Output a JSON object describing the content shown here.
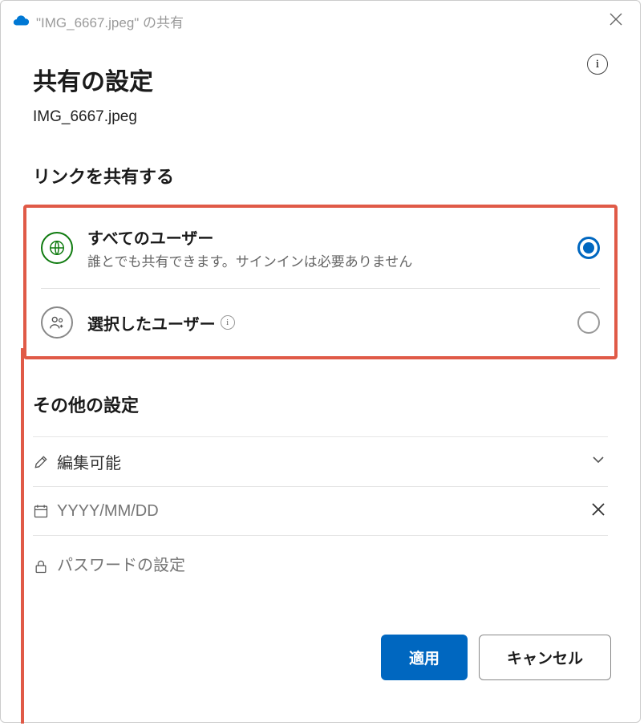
{
  "titlebar": {
    "text": "\"IMG_6667.jpeg\" の共有"
  },
  "header": {
    "title": "共有の設定",
    "filename": "IMG_6667.jpeg"
  },
  "link_section": {
    "heading": "リンクを共有する",
    "options": [
      {
        "title": "すべてのユーザー",
        "desc": "誰とでも共有できます。サインインは必要ありません",
        "selected": true
      },
      {
        "title": "選択したユーザー",
        "desc": "",
        "selected": false
      }
    ]
  },
  "other_section": {
    "heading": "その他の設定",
    "permission_label": "編集可能",
    "date_placeholder": "YYYY/MM/DD",
    "password_placeholder": "パスワードの設定"
  },
  "buttons": {
    "apply": "適用",
    "cancel": "キャンセル"
  }
}
